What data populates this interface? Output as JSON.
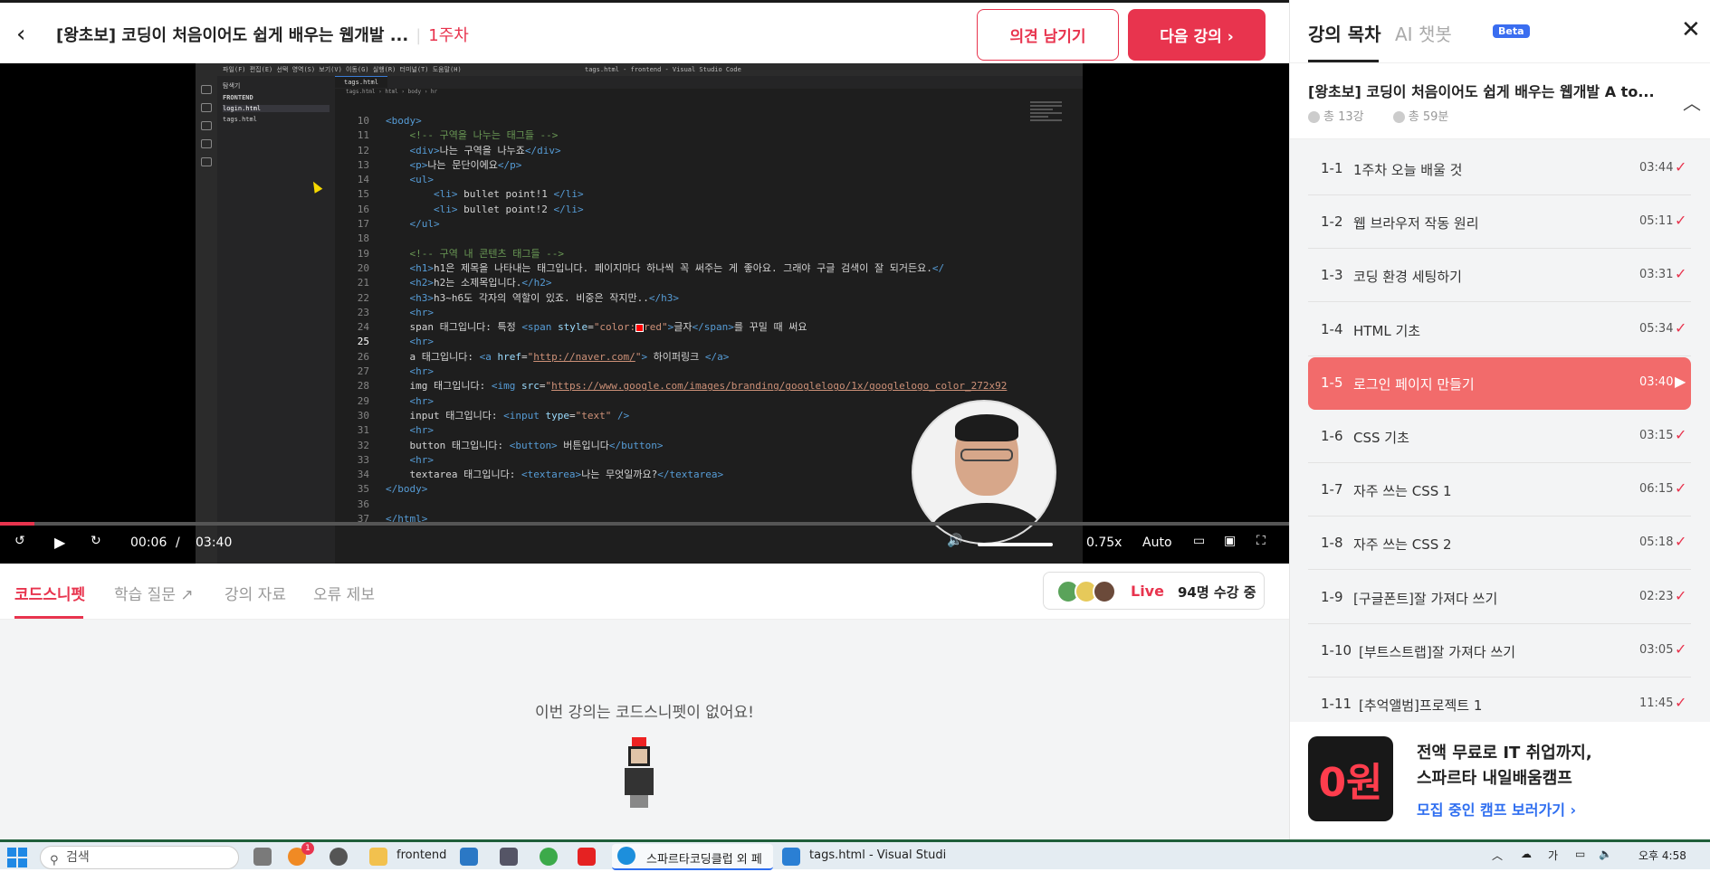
{
  "topbar": {
    "title": "[왕초보] 코딩이 처음이어도 쉽게 배우는 웹개발 ...",
    "week": "1주차",
    "feedback_button": "의견 남기기",
    "next_button": "다음 강의 ›"
  },
  "video": {
    "vscode_title": "tags.html - frontend - Visual Studio Code",
    "vscode_menu": "파일(F)  편집(E)  선택 영역(S)  보기(V)  이동(G)  실행(R)  터미널(T)  도움말(H)",
    "explorer_label": "탐색기",
    "explorer_folder": "FRONTEND",
    "explorer_files": [
      "login.html",
      "tags.html"
    ],
    "editor_tab": "tags.html",
    "breadcrumb": "tags.html › html › body › hr",
    "code_lines": [
      {
        "n": "10",
        "html": "<span class='tag'>&lt;body&gt;</span>"
      },
      {
        "n": "11",
        "html": "    <span class='cmt'>&lt;!-- 구역을 나누는 태그들 --&gt;</span>"
      },
      {
        "n": "12",
        "html": "    <span class='tag'>&lt;div&gt;</span>나는 구역을 나누죠<span class='tag'>&lt;/div&gt;</span>"
      },
      {
        "n": "13",
        "html": "    <span class='tag'>&lt;p&gt;</span>나는 문단이에요<span class='tag'>&lt;/p&gt;</span>"
      },
      {
        "n": "14",
        "html": "    <span class='tag'>&lt;ul&gt;</span>"
      },
      {
        "n": "15",
        "html": "        <span class='tag'>&lt;li&gt;</span> bullet point!1 <span class='tag'>&lt;/li&gt;</span>"
      },
      {
        "n": "16",
        "html": "        <span class='tag'>&lt;li&gt;</span> bullet point!2 <span class='tag'>&lt;/li&gt;</span>"
      },
      {
        "n": "17",
        "html": "    <span class='tag'>&lt;/ul&gt;</span>"
      },
      {
        "n": "18",
        "html": ""
      },
      {
        "n": "19",
        "html": "    <span class='cmt'>&lt;!-- 구역 내 콘텐츠 태그들 --&gt;</span>"
      },
      {
        "n": "20",
        "html": "    <span class='tag'>&lt;h1&gt;</span>h1은 제목을 나타내는 태그입니다. 페이지마다 하나씩 꼭 써주는 게 좋아요. 그래야 구글 검색이 잘 되거든요.<span class='tag'>&lt;/</span>"
      },
      {
        "n": "21",
        "html": "    <span class='tag'>&lt;h2&gt;</span>h2는 소제목입니다.<span class='tag'>&lt;/h2&gt;</span>"
      },
      {
        "n": "22",
        "html": "    <span class='tag'>&lt;h3&gt;</span>h3~h6도 각자의 역할이 있죠. 비중은 작지만..<span class='tag'>&lt;/h3&gt;</span>"
      },
      {
        "n": "23",
        "html": "    <span class='tag'>&lt;hr&gt;</span>"
      },
      {
        "n": "24",
        "html": "    span 태그입니다: 특정 <span class='tag'>&lt;span</span> <span class='attr'>style</span>=<span class='str'>\"color:<i class='sq'></i>red\"</span><span class='tag'>&gt;</span>글자<span class='tag'>&lt;/span&gt;</span>를 꾸밀 때 써요"
      },
      {
        "n": "25",
        "html": "    <span class='tag'>&lt;hr&gt;</span>",
        "cur": true
      },
      {
        "n": "26",
        "html": "    a 태그입니다: <span class='tag'>&lt;a</span> <span class='attr'>href</span>=<span class='str'>\"<span class='url'>http://naver.com/</span>\"</span><span class='tag'>&gt;</span> 하이퍼링크 <span class='tag'>&lt;/a&gt;</span>"
      },
      {
        "n": "27",
        "html": "    <span class='tag'>&lt;hr&gt;</span>"
      },
      {
        "n": "28",
        "html": "    img 태그입니다: <span class='tag'>&lt;img</span> <span class='attr'>src</span>=<span class='str'>\"<span class='url'>https://www.google.com/images/branding/googlelogo/1x/googlelogo_color_272x92</span></span>"
      },
      {
        "n": "29",
        "html": "    <span class='tag'>&lt;hr&gt;</span>"
      },
      {
        "n": "30",
        "html": "    input 태그입니다: <span class='tag'>&lt;input</span> <span class='attr'>type</span>=<span class='str'>\"text\"</span> <span class='tag'>/&gt;</span>"
      },
      {
        "n": "31",
        "html": "    <span class='tag'>&lt;hr&gt;</span>"
      },
      {
        "n": "32",
        "html": "    button 태그입니다: <span class='tag'>&lt;button&gt;</span> 버튼입니다<span class='tag'>&lt;/button&gt;</span>"
      },
      {
        "n": "33",
        "html": "    <span class='tag'>&lt;hr&gt;</span>"
      },
      {
        "n": "34",
        "html": "    textarea 태그입니다: <span class='tag'>&lt;textarea&gt;</span>나는 무엇일까요?<span class='tag'>&lt;/textarea&gt;</span>"
      },
      {
        "n": "35",
        "html": "<span class='tag'>&lt;/body&gt;</span>"
      },
      {
        "n": "36",
        "html": ""
      },
      {
        "n": "37",
        "html": "<span class='tag'>&lt;/html&gt;</span>"
      }
    ],
    "current_time": "00:06",
    "time_separator": "/",
    "duration": "03:40",
    "progress": 0.027,
    "speed": "0.75x",
    "quality": "Auto",
    "volume": 0.85
  },
  "tabs": {
    "items": [
      "코드스니펫",
      "학습 질문",
      "강의 자료",
      "오류 제보"
    ],
    "external_icon": "external-link-icon"
  },
  "live": {
    "label": "Live",
    "count": "94명 수강 중"
  },
  "snippet": {
    "empty_message": "이번 강의는 코드스니펫이 없어요!"
  },
  "sidebar": {
    "tab_toc": "강의 목차",
    "tab_ai": "AI 챗봇",
    "beta": "Beta",
    "course_title": "[왕초보] 코딩이 처음이어도 쉽게 배우는 웹개발 A to...",
    "total_lessons": "총 13강",
    "total_time": "총 59분",
    "lessons": [
      {
        "num": "1-1",
        "title": "1주차 오늘 배울 것",
        "dur": "03:44",
        "mark": "✓"
      },
      {
        "num": "1-2",
        "title": "웹 브라우저 작동 원리",
        "dur": "05:11",
        "mark": "✓"
      },
      {
        "num": "1-3",
        "title": "코딩 환경 세팅하기",
        "dur": "03:31",
        "mark": "✓"
      },
      {
        "num": "1-4",
        "title": "HTML 기초",
        "dur": "05:34",
        "mark": "✓"
      },
      {
        "num": "1-5",
        "title": "로그인 페이지 만들기",
        "dur": "03:40",
        "mark": "▶",
        "active": true
      },
      {
        "num": "1-6",
        "title": "CSS 기초",
        "dur": "03:15",
        "mark": "✓"
      },
      {
        "num": "1-7",
        "title": "자주 쓰는 CSS 1",
        "dur": "06:15",
        "mark": "✓"
      },
      {
        "num": "1-8",
        "title": "자주 쓰는 CSS 2",
        "dur": "05:18",
        "mark": "✓"
      },
      {
        "num": "1-9",
        "title": "[구글폰트]잘 가져다 쓰기",
        "dur": "02:23",
        "mark": "✓"
      },
      {
        "num": "1-10",
        "title": "[부트스트랩]잘 가져다 쓰기",
        "dur": "03:05",
        "mark": "✓"
      },
      {
        "num": "1-11",
        "title": "[추억앨범]프로젝트 1",
        "dur": "11:45",
        "mark": "✓"
      }
    ]
  },
  "promo": {
    "image_text": "0원",
    "line1": "전액 무료로 IT 취업까지,",
    "line2": "스파르타 내일배움캠프",
    "link": "모집 중인 캠프 보러가기 ›"
  },
  "taskbar": {
    "search_placeholder": "검색",
    "apps": [
      {
        "label": "frontend"
      },
      {
        "label": "스파르타코딩클럽 외 페"
      },
      {
        "label": "tags.html - Visual Studi"
      }
    ],
    "clock_time": "오후 4:58",
    "ime": "가",
    "badge": "1"
  },
  "colors": {
    "accent": "#e8344e",
    "active_lesson": "#f26b6b",
    "link_blue": "#2e6ef0"
  }
}
